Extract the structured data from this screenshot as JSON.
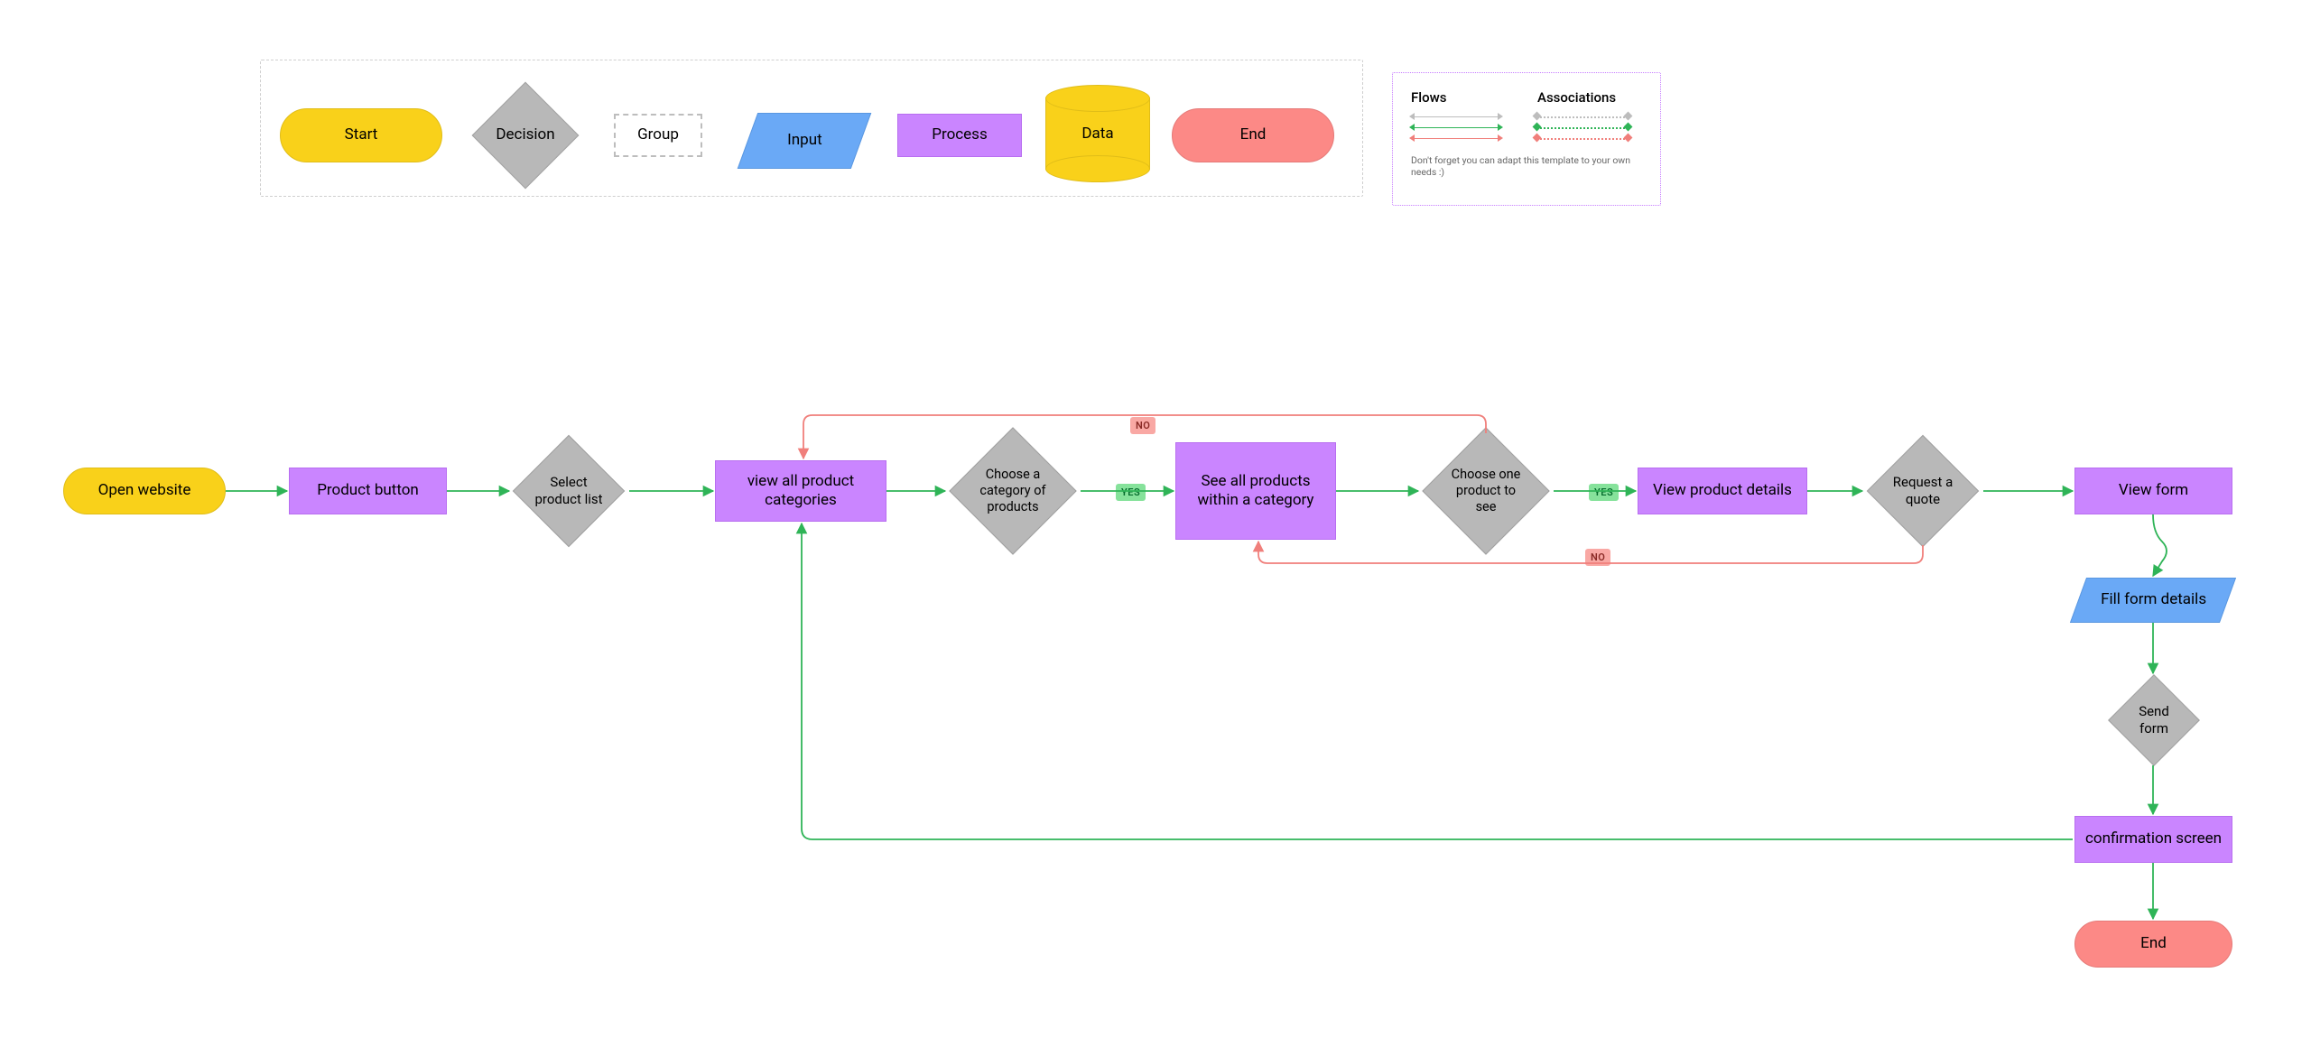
{
  "legend": {
    "start": "Start",
    "decision": "Decision",
    "group": "Group",
    "input": "Input",
    "process": "Process",
    "data": "Data",
    "end": "End"
  },
  "assoc": {
    "flows_title": "Flows",
    "associations_title": "Associations",
    "footnote": "Don't forget you can adapt this template to your own needs :)",
    "colors": {
      "gray": "#bdbdbd",
      "green": "#2fb457",
      "red": "#f07f7b"
    }
  },
  "flow": {
    "n1": "Open website",
    "n2": "Product button",
    "n3": "Select product list",
    "n4": "view all product categories",
    "n5": "Choose a category of products",
    "n6": "See all products within a category",
    "n7": "Choose one product to see",
    "n8": "View product details",
    "n9": "Request a quote",
    "n10": "View form",
    "n11": "Fill form details",
    "n12": "Send form",
    "n13": "confirmation screen",
    "n14": "End"
  },
  "badges": {
    "yes": "YES",
    "no": "NO"
  },
  "colors": {
    "arrow_green": "#2fb457",
    "arrow_red": "#f07f7b",
    "arrow_gray": "#bdbdbd"
  }
}
